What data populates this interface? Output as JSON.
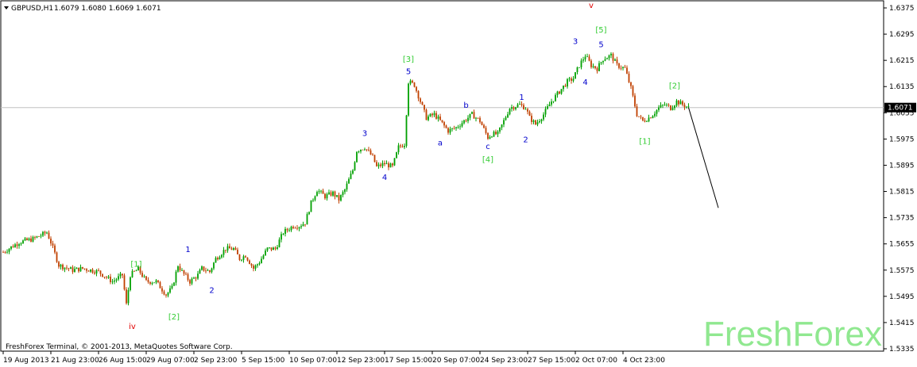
{
  "header": {
    "symbol": "GBPUSD,H1",
    "ohlc": "1.6079 1.6080 1.6069 1.6071"
  },
  "footer": {
    "copyright": "FreshForex Terminal, © 2001-2013, MetaQuotes Software Corp."
  },
  "watermark": "FreshForex",
  "colors": {
    "bull": "#00a000",
    "bear": "#c04000",
    "green_label": "#33cc33",
    "blue_label": "#0000cc",
    "red_label": "#e00000",
    "watermark": "#90e890"
  },
  "chart_data": {
    "type": "candlestick",
    "symbol": "GBPUSD",
    "timeframe": "H1",
    "ylim": [
      1.5335,
      1.6375
    ],
    "x_index_range": [
      0,
      432
    ],
    "yticks": [
      "1.6375",
      "1.6295",
      "1.6215",
      "1.6135",
      "1.6055",
      "1.5975",
      "1.5895",
      "1.5815",
      "1.5735",
      "1.5655",
      "1.5575",
      "1.5495",
      "1.5415",
      "1.5335"
    ],
    "current_price": "1.6071",
    "xticks": [
      {
        "label": "19 Aug 2013",
        "i": 0
      },
      {
        "label": "21 Aug 23:00",
        "i": 24
      },
      {
        "label": "26 Aug 15:00",
        "i": 48
      },
      {
        "label": "29 Aug 07:00",
        "i": 72
      },
      {
        "label": "2 Sep 23:00",
        "i": 96
      },
      {
        "label": "5 Sep 15:00",
        "i": 120
      },
      {
        "label": "10 Sep 07:00",
        "i": 144
      },
      {
        "label": "12 Sep 23:00",
        "i": 168
      },
      {
        "label": "17 Sep 15:00",
        "i": 192
      },
      {
        "label": "20 Sep 07:00",
        "i": 216
      },
      {
        "label": "24 Sep 23:00",
        "i": 240
      },
      {
        "label": "27 Sep 15:00",
        "i": 264
      },
      {
        "label": "2 Oct 07:00",
        "i": 288
      },
      {
        "label": "4 Oct 23:00",
        "i": 312
      }
    ],
    "price_path": [
      [
        0,
        1.563
      ],
      [
        8,
        1.566
      ],
      [
        15,
        1.567
      ],
      [
        22,
        1.569
      ],
      [
        24,
        1.566
      ],
      [
        28,
        1.559
      ],
      [
        35,
        1.5575
      ],
      [
        40,
        1.558
      ],
      [
        48,
        1.557
      ],
      [
        55,
        1.554
      ],
      [
        60,
        1.556
      ],
      [
        62,
        1.547
      ],
      [
        64,
        1.556
      ],
      [
        68,
        1.5578
      ],
      [
        72,
        1.554
      ],
      [
        77,
        1.554
      ],
      [
        82,
        1.55
      ],
      [
        85,
        1.552
      ],
      [
        88,
        1.559
      ],
      [
        90,
        1.557
      ],
      [
        94,
        1.554
      ],
      [
        98,
        1.556
      ],
      [
        100,
        1.558
      ],
      [
        104,
        1.557
      ],
      [
        107,
        1.561
      ],
      [
        112,
        1.564
      ],
      [
        116,
        1.564
      ],
      [
        119,
        1.561
      ],
      [
        122,
        1.562
      ],
      [
        126,
        1.558
      ],
      [
        129,
        1.56
      ],
      [
        133,
        1.564
      ],
      [
        137,
        1.564
      ],
      [
        141,
        1.569
      ],
      [
        146,
        1.571
      ],
      [
        149,
        1.571
      ],
      [
        152,
        1.572
      ],
      [
        155,
        1.578
      ],
      [
        158,
        1.582
      ],
      [
        162,
        1.58
      ],
      [
        166,
        1.581
      ],
      [
        169,
        1.579
      ],
      [
        172,
        1.582
      ],
      [
        176,
        1.588
      ],
      [
        178,
        1.594
      ],
      [
        182,
        1.595
      ],
      [
        186,
        1.592
      ],
      [
        188,
        1.589
      ],
      [
        192,
        1.59
      ],
      [
        196,
        1.589
      ],
      [
        199,
        1.595
      ],
      [
        202,
        1.596
      ],
      [
        204,
        1.615
      ],
      [
        207,
        1.614
      ],
      [
        210,
        1.609
      ],
      [
        213,
        1.604
      ],
      [
        217,
        1.605
      ],
      [
        220,
        1.603
      ],
      [
        224,
        1.6
      ],
      [
        228,
        1.601
      ],
      [
        232,
        1.603
      ],
      [
        236,
        1.605
      ],
      [
        240,
        1.603
      ],
      [
        244,
        1.598
      ],
      [
        246,
        1.599
      ],
      [
        249,
        1.599
      ],
      [
        252,
        1.603
      ],
      [
        255,
        1.607
      ],
      [
        260,
        1.608
      ],
      [
        263,
        1.607
      ],
      [
        265,
        1.604
      ],
      [
        268,
        1.602
      ],
      [
        272,
        1.605
      ],
      [
        276,
        1.609
      ],
      [
        280,
        1.612
      ],
      [
        284,
        1.615
      ],
      [
        287,
        1.616
      ],
      [
        290,
        1.62
      ],
      [
        293,
        1.623
      ],
      [
        296,
        1.62
      ],
      [
        299,
        1.619
      ],
      [
        302,
        1.622
      ],
      [
        306,
        1.623
      ],
      [
        309,
        1.62
      ],
      [
        313,
        1.619
      ],
      [
        316,
        1.613
      ],
      [
        319,
        1.605
      ],
      [
        322,
        1.603
      ],
      [
        325,
        1.604
      ],
      [
        327,
        1.605
      ],
      [
        330,
        1.607
      ],
      [
        333,
        1.608
      ],
      [
        336,
        1.607
      ],
      [
        339,
        1.609
      ],
      [
        342,
        1.608
      ],
      [
        345,
        1.6071
      ]
    ],
    "forecast_line": [
      [
        345,
        1.6071
      ],
      [
        360,
        1.5765
      ]
    ],
    "wave_labels": [
      {
        "text": "v",
        "i": 296,
        "price": 1.6375,
        "color": "red"
      },
      {
        "text": "[5]",
        "i": 301,
        "price": 1.63,
        "color": "green"
      },
      {
        "text": "3",
        "i": 288,
        "price": 1.6265,
        "color": "blue"
      },
      {
        "text": "5",
        "i": 301,
        "price": 1.6255,
        "color": "blue"
      },
      {
        "text": "4",
        "i": 293,
        "price": 1.614,
        "color": "blue"
      },
      {
        "text": "[3]",
        "i": 204,
        "price": 1.621,
        "color": "green"
      },
      {
        "text": "5",
        "i": 204,
        "price": 1.6173,
        "color": "blue"
      },
      {
        "text": "b",
        "i": 233,
        "price": 1.607,
        "color": "blue"
      },
      {
        "text": "1",
        "i": 261,
        "price": 1.6095,
        "color": "blue"
      },
      {
        "text": "a",
        "i": 220,
        "price": 1.5955,
        "color": "blue"
      },
      {
        "text": "c",
        "i": 244,
        "price": 1.5945,
        "color": "blue"
      },
      {
        "text": "2",
        "i": 263,
        "price": 1.5965,
        "color": "blue"
      },
      {
        "text": "[4]",
        "i": 244,
        "price": 1.5905,
        "color": "green"
      },
      {
        "text": "3",
        "i": 182,
        "price": 1.5985,
        "color": "blue"
      },
      {
        "text": "4",
        "i": 192,
        "price": 1.585,
        "color": "blue"
      },
      {
        "text": "[2]",
        "i": 338,
        "price": 1.613,
        "color": "green"
      },
      {
        "text": "[1]",
        "i": 323,
        "price": 1.596,
        "color": "green"
      },
      {
        "text": "1",
        "i": 93,
        "price": 1.563,
        "color": "blue"
      },
      {
        "text": "2",
        "i": 105,
        "price": 1.5505,
        "color": "blue"
      },
      {
        "text": "[1]",
        "i": 67,
        "price": 1.5585,
        "color": "green"
      },
      {
        "text": "[2]",
        "i": 86,
        "price": 1.5425,
        "color": "green"
      },
      {
        "text": "iv",
        "i": 65,
        "price": 1.5395,
        "color": "red"
      }
    ]
  }
}
